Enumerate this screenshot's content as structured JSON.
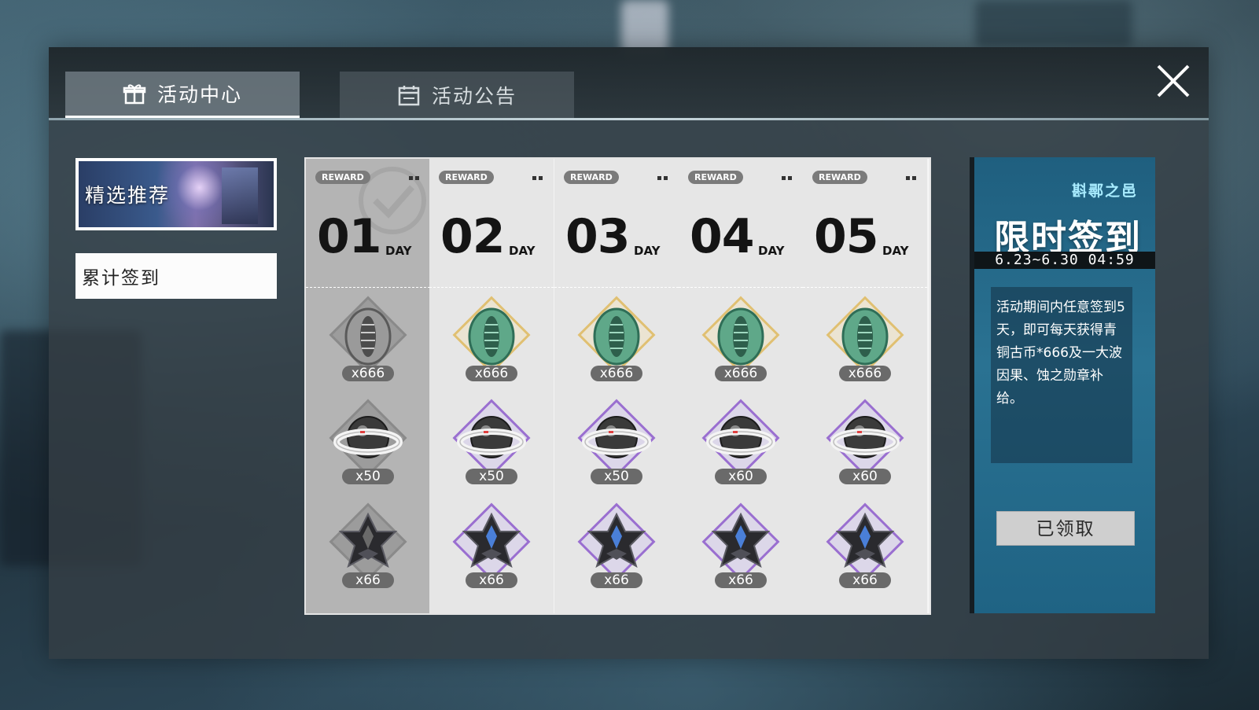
{
  "tabs": [
    {
      "label": "活动中心",
      "icon": "gift-icon",
      "active": true
    },
    {
      "label": "活动公告",
      "icon": "calendar-icon",
      "active": false
    }
  ],
  "sidebar": {
    "featured_label": "精选推荐",
    "checkin_label": "累计签到"
  },
  "calendar": {
    "reward_tag": "REWARD",
    "day_suffix": "DAY",
    "days": [
      {
        "number": "01",
        "claimed": true,
        "items": [
          {
            "icon": "bronze-coin-icon",
            "qty": "x666",
            "frame": "grey"
          },
          {
            "icon": "orb-ring-icon",
            "qty": "x50",
            "frame": "grey"
          },
          {
            "icon": "dark-crystal-icon",
            "qty": "x66",
            "frame": "grey"
          }
        ]
      },
      {
        "number": "02",
        "claimed": false,
        "items": [
          {
            "icon": "bronze-coin-icon",
            "qty": "x666",
            "frame": "gold"
          },
          {
            "icon": "orb-ring-icon",
            "qty": "x50",
            "frame": "purple"
          },
          {
            "icon": "dark-crystal-icon",
            "qty": "x66",
            "frame": "purple"
          }
        ]
      },
      {
        "number": "03",
        "claimed": false,
        "items": [
          {
            "icon": "bronze-coin-icon",
            "qty": "x666",
            "frame": "gold"
          },
          {
            "icon": "orb-ring-icon",
            "qty": "x50",
            "frame": "purple"
          },
          {
            "icon": "dark-crystal-icon",
            "qty": "x66",
            "frame": "purple"
          }
        ]
      },
      {
        "number": "04",
        "claimed": false,
        "items": [
          {
            "icon": "bronze-coin-icon",
            "qty": "x666",
            "frame": "gold"
          },
          {
            "icon": "orb-ring-icon",
            "qty": "x60",
            "frame": "purple"
          },
          {
            "icon": "dark-crystal-icon",
            "qty": "x66",
            "frame": "purple"
          }
        ]
      },
      {
        "number": "05",
        "claimed": false,
        "items": [
          {
            "icon": "bronze-coin-icon",
            "qty": "x666",
            "frame": "gold"
          },
          {
            "icon": "orb-ring-icon",
            "qty": "x60",
            "frame": "purple"
          },
          {
            "icon": "dark-crystal-icon",
            "qty": "x66",
            "frame": "purple"
          }
        ]
      }
    ]
  },
  "event": {
    "city": "斟鄩之邑",
    "title": "限时签到",
    "date_range": "6.23~6.30 04:59",
    "description": "活动期间内任意签到5天，即可每天获得青铜古币*666及一大波因果、蚀之勋章补给。",
    "claim_label": "已领取"
  },
  "colors": {
    "gold_frame": "#e0c072",
    "purple_frame": "#9a6fd0",
    "event_panel": "#2a7292"
  }
}
